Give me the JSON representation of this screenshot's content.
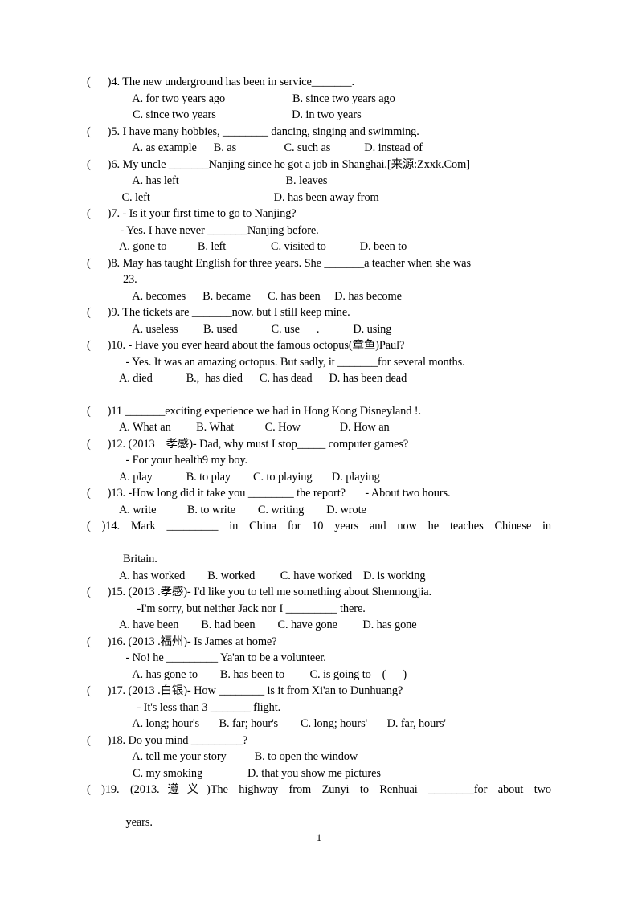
{
  "document": {
    "page_number": "1",
    "questions": [
      {
        "id": "q4",
        "stem": "(      )4. The new underground has been in service_______.",
        "options_rows": [
          "  A. for two years ago                        B. since two years ago",
          "  C. since two years                           D. in two years"
        ]
      },
      {
        "id": "q5",
        "stem": "(      )5. I have many hobbies, ________ dancing, singing and swimming.",
        "options_rows": [
          "  A. as example      B. as                 C. such as            D. instead of"
        ]
      },
      {
        "id": "q6",
        "stem": "(      )6. My uncle _______Nanjing since he got a job in Shanghai.[来源:Zxxk.Com]",
        "options_rows": [
          "  A. has left                                      B. leaves",
          " C. left                                            D. has been away from"
        ]
      },
      {
        "id": "q7",
        "stem": "(      )7. - Is it your first time to go to Nanjing?",
        "continuation": " - Yes. I have never _______Nanjing before.",
        "options_rows": [
          "A. gone to           B. left                C. visited to            D. been to"
        ]
      },
      {
        "id": "q8",
        "stem": "(      )8. May has taught English for three years. She _______a teacher when she was",
        "continuation": "  23.",
        "options_rows": [
          "  A. becomes      B. became      C. has been     D. has become"
        ]
      },
      {
        "id": "q9",
        "stem": "(      )9. The tickets are _______now. but I still keep mine.",
        "options_rows": [
          "  A. useless         B. used            C. use      .            D. using"
        ]
      },
      {
        "id": "q10",
        "stem": "(      )10. - Have you ever heard about the famous octopus(章鱼)Paul?",
        "continuation": "   - Yes. It was an amazing octopus. But sadly, it _______for several months.",
        "options_rows": [
          "A. died            B.,  has died      C. has dead      D. has been dead"
        ]
      },
      {
        "id": "q11",
        "stem": "(      )11 _______exciting experience we had in Hong Kong Disneyland !.",
        "options_rows": [
          "A. What an         B. What           C. How              D. How an"
        ]
      },
      {
        "id": "q12",
        "stem": "(      )12. (2013    孝感)- Dad, why must I stop_____ computer games?",
        "continuation": "   - For your health9 my boy.",
        "options_rows": [
          "A. play            B. to play        C. to playing       D. playing"
        ]
      },
      {
        "id": "q13",
        "stem": "(      )13. -How long did it take you ________ the report?       - About two hours.",
        "options_rows": [
          "A. write           B. to write        C. writing        D. wrote"
        ]
      },
      {
        "id": "q14",
        "stem": "(      )14. Mark _________ in China for 10 years and now he teaches Chinese in",
        "continuation": "  Britain.",
        "options_rows": [
          "A. has worked        B. worked         C. have worked    D. is working"
        ]
      },
      {
        "id": "q15",
        "stem": "(      )15. (2013 .孝感)- I'd like you to tell me something about Shennongjia.",
        "continuation": "       -I'm sorry, but neither Jack nor I _________ there.",
        "options_rows": [
          "A. have been        B. had been        C. have gone         D. has gone"
        ]
      },
      {
        "id": "q16",
        "stem": "(      )16. (2013 .福州)- Is James at home?",
        "continuation": "   - No! he _________ Ya'an to be a volunteer.",
        "options_rows": [
          "  A. has gone to        B. has been to         C. is going to    (      )"
        ]
      },
      {
        "id": "q17",
        "stem": "(      )17. (2013 .白银)- How ________ is it from Xi'an to Dunhuang?",
        "continuation": "       - It's less than 3 _______ flight.",
        "options_rows": [
          "  A. long; hour's       B. far; hour's        C. long; hours'       D. far, hours'"
        ]
      },
      {
        "id": "q18",
        "stem": "(      )18. Do you mind _________?",
        "options_rows": [
          "  A. tell me your story          B. to open the window",
          "  C. my smoking                D. that you show me pictures"
        ]
      },
      {
        "id": "q19",
        "stem": "(      )19. (2013.遵义)The highway from Zunyi to Renhuai ________for about two",
        "continuation": "   years."
      }
    ]
  }
}
